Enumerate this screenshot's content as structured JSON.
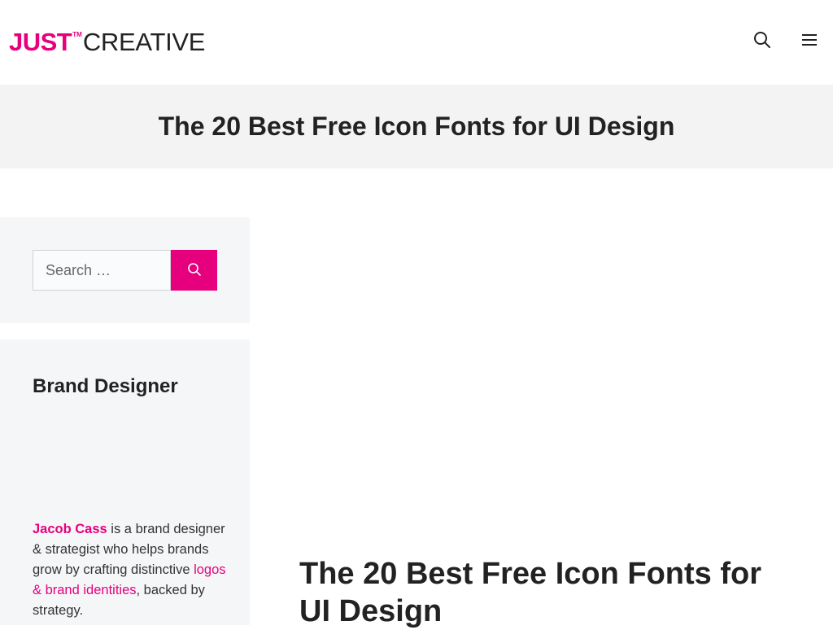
{
  "colors": {
    "accent": "#e6007e",
    "text": "#222222",
    "hero_bg": "#f3f3f3",
    "sidebar_bg": "#f5f6f8"
  },
  "header": {
    "logo": {
      "part1": "JUST",
      "tm": "TM",
      "part2": "CREATIVE"
    },
    "icons": [
      "search-icon",
      "menu-icon"
    ]
  },
  "hero": {
    "title": "The 20 Best Free Icon Fonts for UI Design"
  },
  "sidebar": {
    "search": {
      "placeholder": "Search …",
      "value": "",
      "submit_icon": "search-icon"
    },
    "bio": {
      "title": "Brand Designer",
      "name_link": "Jacob Cass",
      "text_1": " is a brand designer & strategist who helps brands grow by crafting distinctive ",
      "link_2": "logos & brand identities",
      "text_2": ", backed by strategy."
    }
  },
  "article": {
    "title": "The 20 Best Free Icon Fonts for UI Design"
  }
}
